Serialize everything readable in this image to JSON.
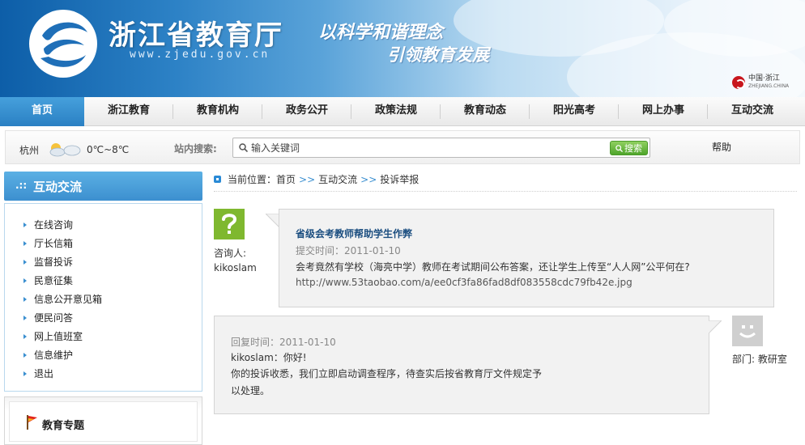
{
  "header": {
    "title": "浙江省教育厅",
    "url": "www.zjedu.gov.cn",
    "slogan_line1": "以科学和谐理念",
    "slogan_line2": "引领教育发展",
    "corner_logo_cn": "中国·浙江",
    "corner_logo_en": "ZHEJIANG.CHINA"
  },
  "nav": {
    "items": [
      {
        "label": "首页",
        "active": true
      },
      {
        "label": "浙江教育"
      },
      {
        "label": "教育机构"
      },
      {
        "label": "政务公开"
      },
      {
        "label": "政策法规"
      },
      {
        "label": "教育动态"
      },
      {
        "label": "阳光高考"
      },
      {
        "label": "网上办事"
      },
      {
        "label": "互动交流"
      }
    ]
  },
  "toolbar": {
    "city": "杭州",
    "temperature": "0℃~8℃",
    "search_label": "站内搜索:",
    "search_placeholder": "输入关键词",
    "search_button": "搜索",
    "help": "帮助"
  },
  "sidebar": {
    "title_dots": ".::",
    "title": "互动交流",
    "items": [
      {
        "label": "在线咨询"
      },
      {
        "label": "厅长信箱"
      },
      {
        "label": "监督投诉"
      },
      {
        "label": "民意征集"
      },
      {
        "label": "信息公开意见箱"
      },
      {
        "label": "便民问答"
      },
      {
        "label": "网上值班室"
      },
      {
        "label": "信息维护"
      },
      {
        "label": "退出"
      }
    ],
    "topic_title": "教育专题"
  },
  "breadcrumb": {
    "prefix": "当前位置：",
    "items": [
      "首页",
      "互动交流",
      "投诉举报"
    ],
    "separator": ">>"
  },
  "question": {
    "asker_label": "咨询人:",
    "asker_name": "kikoslam",
    "title": "省级会考教师帮助学生作弊",
    "time": "提交时间：2011-01-10",
    "text": "会考竟然有学校（海亮中学）教师在考试期间公布答案，还让学生上传至“人人网”公平何在?",
    "link": "http://www.53taobao.com/a/ee0cf3fa86fad8df083558cdc79fb42e.jpg"
  },
  "reply": {
    "time": "回复时间：2011-01-10",
    "line1": "kikoslam：你好!",
    "line2": "你的投诉收悉，我们立即启动调查程序，待查实后按省教育厅文件规定予",
    "line3": "以处理。",
    "dept": "部门: 教研室"
  },
  "colors": {
    "accent_blue": "#2a80c3",
    "question_avatar": "#7fb82f",
    "search_button": "#4fa52b"
  }
}
